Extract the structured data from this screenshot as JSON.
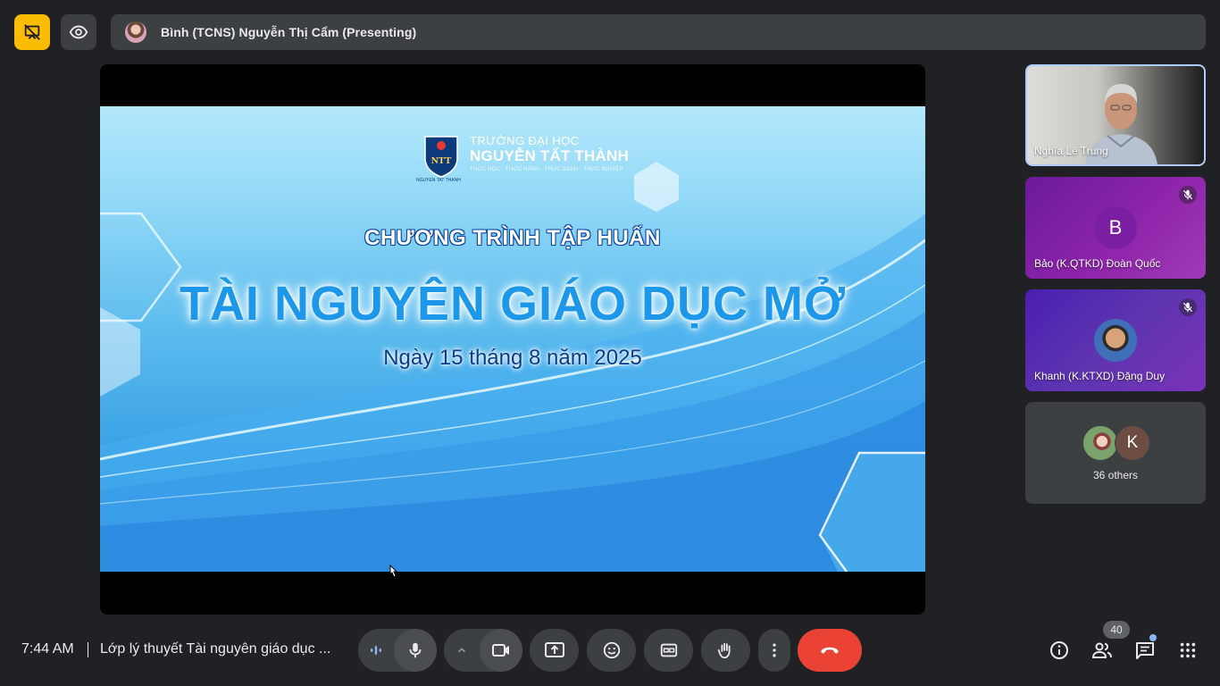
{
  "header": {
    "presenter_label": "Bình (TCNS) Nguyễn Thị Cẩm (Presenting)"
  },
  "slide": {
    "school_top": "TRƯỜNG ĐẠI HỌC",
    "school_name": "NGUYỄN TẤT THÀNH",
    "school_tagline": "THỰC HỌC · THỰC HÀNH · THỰC DANH · THỰC NGHIỆP",
    "logo_initials": "NTT",
    "logo_under": "NGUYEN TAT THANH",
    "subtitle": "CHƯƠNG TRÌNH TẬP HUẤN",
    "title": "TÀI NGUYÊN GIÁO DỤC MỞ",
    "date": "Ngày 15 tháng 8 năm 2025"
  },
  "participants": [
    {
      "name": "Nghĩa Lê Trung",
      "type": "video",
      "muted": false
    },
    {
      "name": "Bảo (K.QTKD) Đoàn Quốc",
      "initial": "B",
      "muted": true
    },
    {
      "name": "Khanh (K.KTXD) Đặng Duy",
      "muted": true
    },
    {
      "name": "36 others",
      "initial": "K"
    }
  ],
  "bottom": {
    "time": "7:44 AM",
    "meeting_title": "Lớp lý thuyết Tài nguyên giáo dục ...",
    "people_count": "40"
  },
  "colors": {
    "background": "#202124",
    "control": "#3c4043",
    "hide_button": "#fbbc04",
    "end_call": "#ea4335",
    "active_border": "#aecbfa",
    "notification": "#8ab4f8"
  },
  "icons": {
    "hide_button": "presentation-hide-icon",
    "view_button": "eye-icon",
    "mic": "mic-icon",
    "camera": "videocam-icon",
    "present": "present-to-all-icon",
    "emoji": "emoji-icon",
    "captions": "closed-caption-icon",
    "hand": "raise-hand-icon",
    "more": "more-vert-icon",
    "end": "call-end-icon",
    "info": "info-icon",
    "people": "people-icon",
    "chat": "chat-icon",
    "apps": "apps-icon"
  }
}
